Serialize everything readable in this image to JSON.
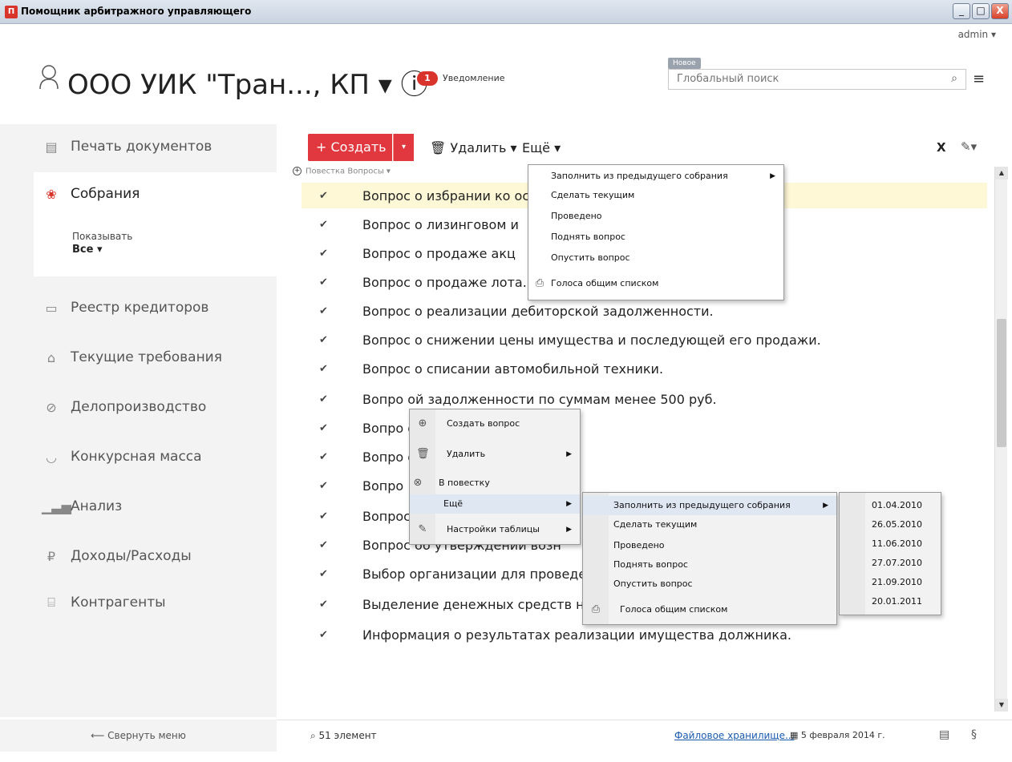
{
  "window": {
    "title": "Помощник арбитражного управляющего",
    "app_icon": "П",
    "minimize": "_",
    "maximize": "□",
    "close": "X"
  },
  "header": {
    "user": "admin ▾",
    "org_title": "ООО УИК \"Тран..., КП ▾ ⓘ",
    "notification_count": "1",
    "notification_label": "Уведомление",
    "new_tag": "Новое",
    "search_placeholder": "Глобальный поиск"
  },
  "sidebar": {
    "items": [
      {
        "label": "Печать документов",
        "icon": "print-doc-icon"
      },
      {
        "label": "Собрания",
        "icon": "handshake-icon"
      },
      {
        "label": "Реестр кредиторов",
        "icon": "registry-icon"
      },
      {
        "label": "Текущие требования",
        "icon": "pin-icon"
      },
      {
        "label": "Делопроизводство",
        "icon": "paperclip-icon"
      },
      {
        "label": "Конкурсная масса",
        "icon": "basket-icon"
      },
      {
        "label": "Анализ",
        "icon": "chart-icon"
      },
      {
        "label": "Доходы/Расходы",
        "icon": "money-icon"
      },
      {
        "label": "Контрагенты",
        "icon": "bank-icon"
      }
    ],
    "show_label": "Показывать",
    "show_value": "Все ▾",
    "collapse": "⟵ Свернуть меню"
  },
  "toolbar": {
    "create": "+ Создать",
    "create_dd": "▾",
    "delete": "🗑 Удалить ▾",
    "more": "Ещё ▾",
    "excel": "X",
    "settings": "▾"
  },
  "breadcrumb": "Повестка Вопросы ▾",
  "rows": [
    "Вопрос о избрании ко                                                        оставе.",
    "Вопрос о лизинговом и",
    "Вопрос о продаже акц",
    "Вопрос о продаже лота.",
    "Вопрос о реализации дебиторской задолженности.",
    "Вопрос о снижении цены имущества и последующей его продажи.",
    "Вопрос о списании автомобильной техники.",
    "Вопро                              ой задолженности по суммам менее 500 руб.",
    "Вопро                              ооружений.",
    "Вопро                                                                                              ольз...",
    "Вопро",
    "Вопрос о ходатайстве в АС о                                                            а.",
    "Вопрос об утверждении возн",
    "Выбор организации для проведения независимой оценки имущества должника.",
    "Выделение денежных средств на судебную экспертизу.",
    "Информация о результатах реализации имущества должника."
  ],
  "more_menu": {
    "items": [
      {
        "label": "Заполнить из предыдущего собрания",
        "arrow": "▶"
      },
      {
        "label": "Сделать текущим"
      },
      {
        "label": "Проведено"
      },
      {
        "label": "Поднять вопрос"
      },
      {
        "label": "Опустить вопрос"
      },
      {
        "label": "Голоса общим списком",
        "icon": "printer-icon"
      }
    ]
  },
  "context_menu": {
    "items": [
      {
        "label": "Создать вопрос",
        "icon": "plus-circle-icon"
      },
      {
        "label": "Удалить",
        "icon": "trash-icon",
        "arrow": "▶"
      },
      {
        "label": "В повестку",
        "icon": "x-circle-icon"
      },
      {
        "label": "Ещё",
        "arrow": "▶"
      },
      {
        "label": "Настройки таблицы",
        "icon": "table-settings-icon",
        "arrow": "▶"
      }
    ]
  },
  "sub_menu": {
    "items": [
      {
        "label": "Заполнить из предыдущего собрания",
        "arrow": "▶"
      },
      {
        "label": "Сделать текущим"
      },
      {
        "label": "Проведено"
      },
      {
        "label": "Поднять вопрос"
      },
      {
        "label": "Опустить вопрос"
      },
      {
        "label": "Голоса общим списком",
        "icon": "printer-icon"
      }
    ]
  },
  "dates_menu": [
    "01.04.2010",
    "26.05.2010",
    "11.06.2010",
    "27.07.2010",
    "21.09.2010",
    "20.01.2011"
  ],
  "status": {
    "count": "51 элемент",
    "storage_link": "Файловое хранилище...",
    "date": "5 февраля 2014 г."
  },
  "colors": {
    "accent": "#e0383e",
    "selected_row": "#fff8d6",
    "sidebar_bg": "#f3f3f3",
    "link": "#1a5bb0"
  }
}
